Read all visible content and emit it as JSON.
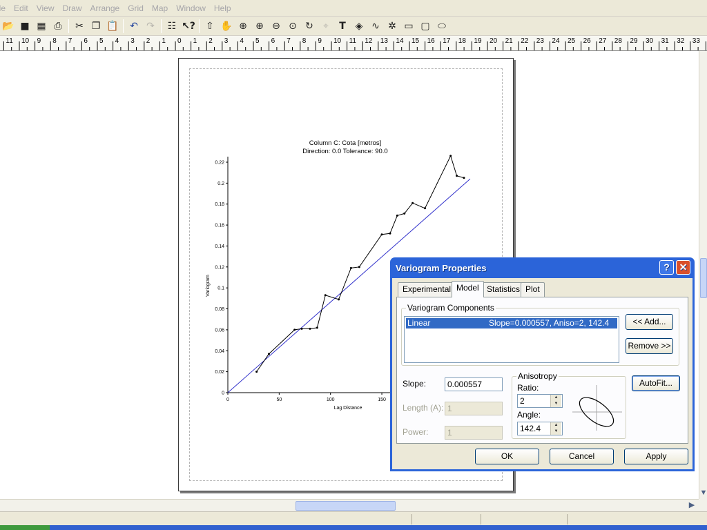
{
  "menu": [
    "ile",
    "Edit",
    "View",
    "Draw",
    "Arrange",
    "Grid",
    "Map",
    "Window",
    "Help"
  ],
  "toolbar": {
    "icons": [
      "open-icon",
      "save-icon",
      "worksheet-icon",
      "print-icon",
      "cut-icon",
      "copy-icon",
      "paste-icon",
      "undo-icon",
      "redo-icon",
      "object-manager-icon",
      "whats-this-icon",
      "select-arrow-icon",
      "pan-icon",
      "zoom-rectangle-icon",
      "zoom-in-icon",
      "zoom-out-icon",
      "zoom-page-icon",
      "redraw-icon",
      "crosshair-icon",
      "text-icon",
      "polygon-icon",
      "polyline-icon",
      "symbol-icon",
      "rectangle-icon",
      "rounded-rectangle-icon",
      "ellipse-icon"
    ]
  },
  "ruler": {
    "start": -11,
    "end": 34
  },
  "chart": {
    "title": "Column C:  Cota [metros]",
    "subtitle": "Direction: 0.0   Tolerance: 90.0",
    "xlabel": "Lag Distance",
    "ylabel": "Variogram"
  },
  "chart_data": {
    "type": "line",
    "title": "Column C:  Cota [metros]",
    "subtitle": "Direction: 0.0   Tolerance: 90.0",
    "xlabel": "Lag Distance",
    "ylabel": "Variogram",
    "xlim": [
      0,
      230
    ],
    "ylim": [
      0,
      0.22
    ],
    "xticks": [
      0,
      50,
      100,
      150
    ],
    "yticks": [
      0,
      0.02,
      0.04,
      0.06,
      0.08,
      0.1,
      0.12,
      0.14,
      0.16,
      0.18,
      0.2,
      0.22
    ],
    "ytick_labels": [
      "0",
      "0.02",
      "0.04",
      "0.06",
      "0.08",
      "0.1",
      "0.12",
      "0.14",
      "0.16",
      "0.18",
      "0.2",
      "0.22"
    ],
    "series": [
      {
        "values": [
          [
            28,
            0.02
          ],
          [
            40,
            0.037
          ],
          [
            65,
            0.06
          ],
          [
            72,
            0.061
          ],
          [
            80,
            0.061
          ],
          [
            87,
            0.062
          ],
          [
            95,
            0.093
          ],
          [
            108,
            0.089
          ],
          [
            120,
            0.119
          ],
          [
            128,
            0.12
          ],
          [
            150,
            0.151
          ],
          [
            158,
            0.152
          ],
          [
            165,
            0.169
          ],
          [
            172,
            0.171
          ],
          [
            180,
            0.181
          ],
          [
            192,
            0.176
          ],
          [
            217,
            0.226
          ],
          [
            223,
            0.207
          ],
          [
            230,
            0.205
          ]
        ]
      },
      {
        "values": [
          [
            0,
            0
          ],
          [
            236,
            0.204
          ]
        ]
      }
    ],
    "colors": {
      "experimental": "#000000",
      "model": "#3333cc"
    }
  },
  "dialog": {
    "title": "Variogram Properties",
    "help_glyph": "?",
    "close_glyph": "✕",
    "tabs": [
      "Experimental",
      "Model",
      "Statistics",
      "Plot"
    ],
    "active_tab": "Model",
    "components_group": "Variogram Components",
    "component": {
      "name": "Linear",
      "detail": "Slope=0.000557, Aniso=2, 142.4"
    },
    "add_label": "<<  Add...",
    "remove_label": "Remove >>",
    "slope_label": "Slope:",
    "slope_value": "0.000557",
    "length_label": "Length (A):",
    "length_value": "1",
    "power_label": "Power:",
    "power_value": "1",
    "anisotropy_group": "Anisotropy",
    "ratio_label": "Ratio:",
    "ratio_value": "2",
    "angle_label": "Angle:",
    "angle_value": "142.4",
    "autofit_label": "AutoFit...",
    "ok_label": "OK",
    "cancel_label": "Cancel",
    "apply_label": "Apply"
  }
}
